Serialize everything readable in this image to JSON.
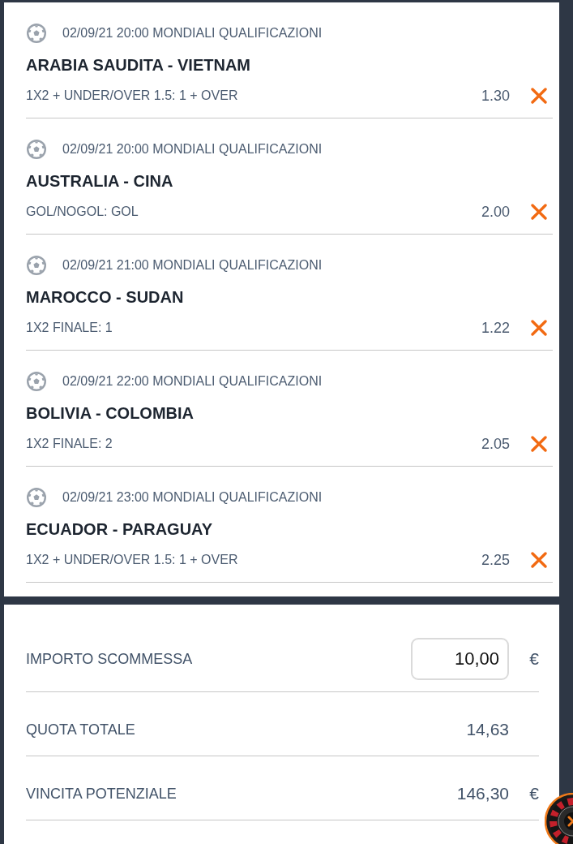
{
  "selections": [
    {
      "meta": "02/09/21 20:00 MONDIALI QUALIFICAZIONI",
      "match": "ARABIA SAUDITA - VIETNAM",
      "market": "1X2 + UNDER/OVER 1.5: 1 + OVER",
      "odds": "1.30"
    },
    {
      "meta": "02/09/21 20:00 MONDIALI QUALIFICAZIONI",
      "match": "AUSTRALIA - CINA",
      "market": "GOL/NOGOL: GOL",
      "odds": "2.00"
    },
    {
      "meta": "02/09/21 21:00 MONDIALI QUALIFICAZIONI",
      "match": "MAROCCO - SUDAN",
      "market": "1X2 FINALE: 1",
      "odds": "1.22"
    },
    {
      "meta": "02/09/21 22:00 MONDIALI QUALIFICAZIONI",
      "match": "BOLIVIA - COLOMBIA",
      "market": "1X2 FINALE: 2",
      "odds": "2.05"
    },
    {
      "meta": "02/09/21 23:00 MONDIALI QUALIFICAZIONI",
      "match": "ECUADOR - PARAGUAY",
      "market": "1X2 + UNDER/OVER 1.5: 1 + OVER",
      "odds": "2.25"
    }
  ],
  "summary": [
    {
      "kind": "input",
      "label": "IMPORTO SCOMMESSA",
      "value": "10,00",
      "currency": "€"
    },
    {
      "kind": "value",
      "label": "QUOTA TOTALE",
      "value": "14,63"
    },
    {
      "kind": "value",
      "label": "VINCITA POTENZIALE",
      "value": "146,30",
      "currency": "€"
    }
  ]
}
